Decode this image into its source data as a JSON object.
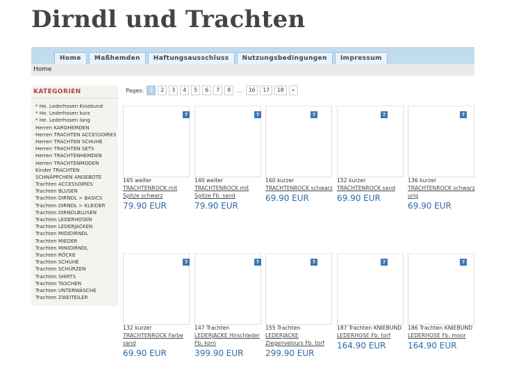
{
  "site": {
    "title": "Dirndl und Trachten"
  },
  "nav": {
    "tabs": [
      "Home",
      "Maßhemden",
      "Haftungsausschluss",
      "Nutzungsbedingungen",
      "Impressum"
    ]
  },
  "breadcrumb": {
    "label": "Home"
  },
  "sidebar": {
    "title": "KATEGORIEN",
    "items": [
      "* He. Lederhosen Kniebund",
      "* He. Lederhosen kurz",
      "* He. Lederhosen lang",
      "Herren KAROHEMDEN",
      "Herren TRACHTEN ACCESSOIRES",
      "Herren TRACHTEN SCHUHE",
      "Herren TRACHTEN SETS",
      "Herren TRACHTENHEMDEN",
      "Herren TRACHTENMODEN",
      "Kinder TRACHTEN",
      "SCHNÄPPCHEN ANGEBOTE",
      "Trachten ACCESSOIRES",
      "Trachten BLUSEN",
      "Trachten DIRNDL > BASICS",
      "Trachten DIRNDL > KLEIDER",
      "Trachten DIRNDLBLUSEN",
      "Trachten LEDERHOSEN",
      "Trachten LEDERJACKEN",
      "Trachten MIDIDIRNDL",
      "Trachten MIEDER",
      "Trachten MINIDIRNDL",
      "Trachten RÖCKE",
      "Trachten SCHUHE",
      "Trachten SCHÜRZEN",
      "Trachten SHIRTS",
      "Trachten TASCHEN",
      "Trachten UNTERWÄSCHE",
      "Trachten ZWEITEILER"
    ]
  },
  "pager": {
    "label": "Pages:",
    "current": "1",
    "pages": [
      "2",
      "3",
      "4",
      "5",
      "6",
      "7",
      "8"
    ],
    "ellipsis": "...",
    "last_pages": [
      "16",
      "17",
      "18"
    ],
    "next": "»"
  },
  "product_icon": "?",
  "products": [
    {
      "prefix": "165 weiter",
      "link": "TRACHTENROCK mit Spitze schwarz",
      "price": "79.90 EUR"
    },
    {
      "prefix": "140 weiter",
      "link": "TRACHTENROCK mit Spitze Fb. sand",
      "price": "79.90 EUR"
    },
    {
      "prefix": "160 kurzer",
      "link": "TRACHTENROCK schwarz",
      "price": "69.90 EUR"
    },
    {
      "prefix": "152 kurzer",
      "link": "TRACHTENROCK sand",
      "price": "69.90 EUR"
    },
    {
      "prefix": "136 kurzer",
      "link": "TRACHTENROCK schwarz urig",
      "price": "69.90 EUR"
    },
    {
      "prefix": "132 kurzer",
      "link": "TRACHTENROCK Farbe sand",
      "price": "69.90 EUR"
    },
    {
      "prefix": "147 Trachten",
      "link": "LEDERJACKE Hirschleder Fb. korn",
      "price": "399.90 EUR"
    },
    {
      "prefix": "155 Trachten",
      "link": "LEDERJACKE Ziegenvelours Fb. torf",
      "price": "299.90 EUR"
    },
    {
      "prefix": "187 Trachten KNIEBUND",
      "link": "LEDERHOSE Fb. torf",
      "price": "164.90 EUR"
    },
    {
      "prefix": "186 Trachten KNIEBUND",
      "link": "LEDERHOSE Fb. moor",
      "price": "164.90 EUR"
    }
  ],
  "colors": {
    "nav_bar": "#c2dcef",
    "price": "#2d6aa6",
    "sidebar_title": "#b04040",
    "icon": "#3f77b8"
  }
}
